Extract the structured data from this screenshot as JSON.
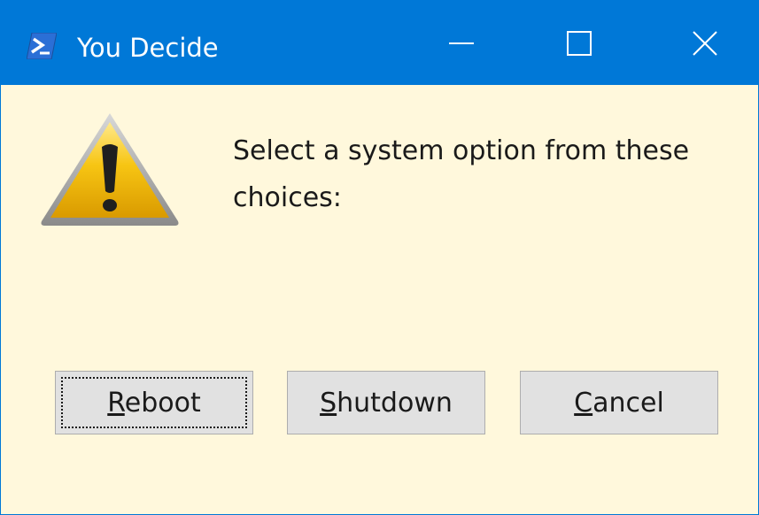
{
  "window": {
    "title": "You Decide",
    "titlebar_color": "#0078d7",
    "background_color": "#fff8dc",
    "app_icon": "powershell-icon",
    "controls": {
      "minimize_icon": "minimize-icon",
      "maximize_icon": "maximize-icon",
      "close_icon": "close-icon"
    }
  },
  "dialog": {
    "icon": "warning-icon",
    "message": "Select a system option from these choices:",
    "buttons": [
      {
        "label": "Reboot",
        "mnemonic": "R",
        "rest": "eboot",
        "focused": true
      },
      {
        "label": "Shutdown",
        "mnemonic": "S",
        "rest": "hutdown",
        "focused": false
      },
      {
        "label": "Cancel",
        "mnemonic": "C",
        "rest": "ancel",
        "focused": false
      }
    ]
  }
}
